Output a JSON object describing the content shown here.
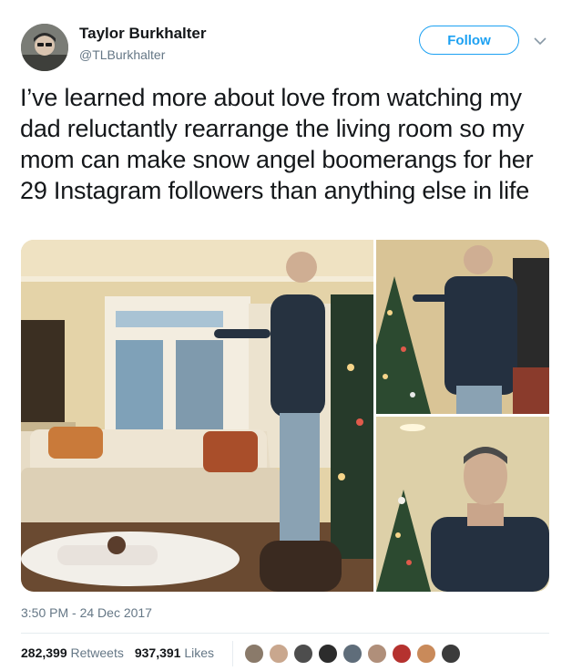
{
  "author": {
    "name": "Taylor Burkhalter",
    "handle": "@TLBurkhalter",
    "avatar": "person-avatar"
  },
  "follow_label": "Follow",
  "menu_icon": "chevron-down-icon",
  "tweet_text": "I’ve learned more about love from watching my dad reluctantly rearrange the living room so my mom can make snow angel boomerangs for her 29 Instagram followers than anything else in life",
  "media": {
    "photos": [
      "living-room-photo",
      "christmas-tree-photo",
      "man-portrait-photo"
    ]
  },
  "timestamp": "3:50 PM - 24 Dec 2017",
  "stats": {
    "retweets_count": "282,399",
    "retweets_label": "Retweets",
    "likes_count": "937,391",
    "likes_label": "Likes"
  },
  "likers": [
    {
      "color": "#8a7a6a"
    },
    {
      "color": "#c9a78e"
    },
    {
      "color": "#4d4d4d"
    },
    {
      "color": "#2c2c2c"
    },
    {
      "color": "#5f6d7a"
    },
    {
      "color": "#b08f7a"
    },
    {
      "color": "#b5322f"
    },
    {
      "color": "#c98a5a"
    },
    {
      "color": "#3b3b3b"
    }
  ],
  "colors": {
    "accent": "#1da1f2",
    "secondary_text": "#657786",
    "primary_text": "#14171a"
  }
}
